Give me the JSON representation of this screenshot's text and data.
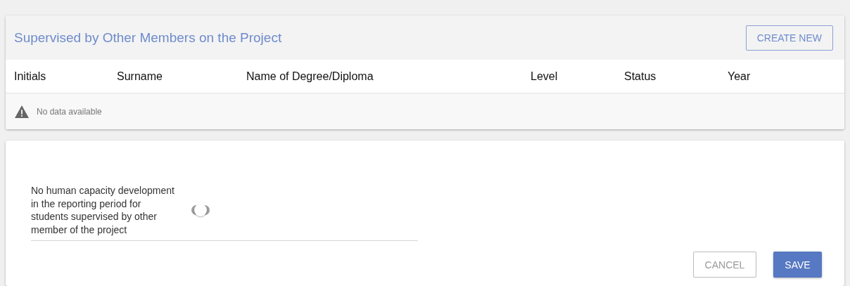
{
  "section": {
    "title": "Supervised by Other Members on the Project",
    "create_button": "CREATE NEW"
  },
  "table": {
    "columns": [
      "Initials",
      "Surname",
      "Name of Degree/Diploma",
      "Level",
      "Status",
      "Year"
    ],
    "empty_message": "No data available"
  },
  "form": {
    "toggle": {
      "label": "No human capacity development in the reporting period for students supervised by other member of the project",
      "on": false
    }
  },
  "buttons": [
    {
      "label": "CANCEL",
      "kind": "secondary"
    },
    {
      "label": "SAVE",
      "kind": "primary"
    }
  ]
}
